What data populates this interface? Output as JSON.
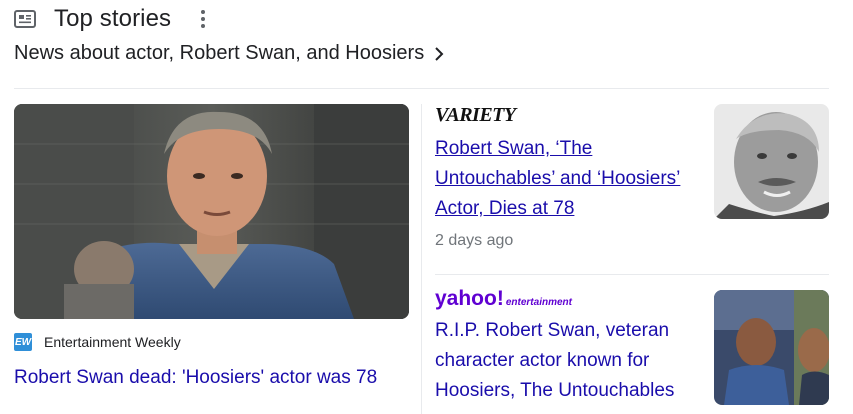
{
  "header": {
    "title": "Top stories",
    "subtitle": "News about actor, Robert Swan, and Hoosiers",
    "icons": {
      "news": "newspaper-icon",
      "more": "more-vert-icon",
      "chevron": "chevron-right-icon"
    }
  },
  "left_story": {
    "source_logo": "EW",
    "source": "Entertainment Weekly",
    "headline": "Robert Swan dead: 'Hoosiers' actor was 78"
  },
  "right_stories": [
    {
      "source_logo": "VARIETY",
      "headline": "Robert Swan, ‘The Untouchables’ and ‘Hoosiers’ Actor, Dies at 78",
      "time": "2 days ago"
    },
    {
      "source_logo": "yahoo!",
      "source_logo_sub": "entertainment",
      "headline": "R.I.P. Robert Swan, veteran character actor known for Hoosiers, The Untouchables"
    }
  ],
  "colors": {
    "link": "#1a0dab",
    "muted": "#70757a",
    "yahoo": "#6001d2",
    "ew": "#2f8fd8"
  }
}
